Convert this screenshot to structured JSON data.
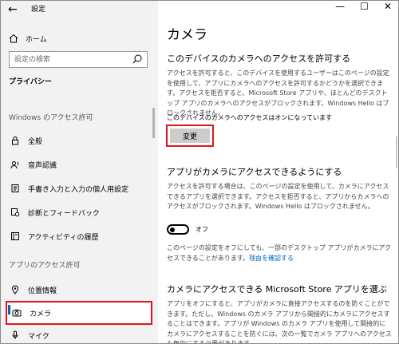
{
  "window": {
    "title": "設定",
    "controls": {
      "minimize": "—",
      "maximize": "☐",
      "close": "✕"
    }
  },
  "sidebar": {
    "home_label": "ホーム",
    "search_placeholder": "設定の検索",
    "category": "プライバシー",
    "section1": "Windows のアクセス許可",
    "items1": [
      {
        "label": "全般",
        "icon": "lock-icon"
      },
      {
        "label": "音声認識",
        "icon": "speech-icon"
      },
      {
        "label": "手書き入力と入力の個人用設定",
        "icon": "pen-icon"
      },
      {
        "label": "診断とフィードバック",
        "icon": "diagnostics-icon"
      },
      {
        "label": "アクティビティの履歴",
        "icon": "history-icon"
      }
    ],
    "section2": "アプリのアクセス許可",
    "items2": [
      {
        "label": "位置情報",
        "icon": "location-icon"
      },
      {
        "label": "カメラ",
        "icon": "camera-icon",
        "active": true
      },
      {
        "label": "マイク",
        "icon": "mic-icon"
      }
    ]
  },
  "main": {
    "page_title": "カメラ",
    "section1": {
      "heading": "このデバイスのカメラへのアクセスを許可する",
      "description": "アクセスを許可すると、このデバイスを使用するユーザーはこのページの設定を使用して、アプリにカメラへのアクセスを許可するかどうかを選択できます。アクセスを拒否すると、Microsoft Store アプリや、ほとんどのデスクトップ アプリのカメラへのアクセスがブロックされます。Windows Hello はブロックされません。",
      "status": "このデバイスのカメラへのアクセスはオンになっています",
      "change_button": "変更"
    },
    "section2": {
      "heading": "アプリがカメラにアクセスできるようにする",
      "description": "アクセスを許可する場合は、このページの設定を使用して、カメラにアクセスできるアプリを選択できます。アクセスを拒否すると、アプリからカメラへのアクセスがブロックされます。Windows Hello はブロックされません。",
      "toggle_label": "オフ",
      "toggle_state": "off",
      "note": "このページの設定をオフにしても、一部のデスクトップ アプリがカメラにアクセスできることがあります。",
      "link": "理由を確認する"
    },
    "section3": {
      "heading": "カメラにアクセスできる Microsoft Store アプリを選ぶ",
      "description": "アプリをオフにすると、アプリがカメラに直接アクセスするのを防ぐことができます。ただし、Windows のカメラ アプリから間接的にカメラにアクセスすることはできます。アプリが Windows のカメラ アプリを使用して間接的にカメラにアクセスすることを防ぐには、次の一覧でカメラ アプリへのアクセスも無効にする必要があります。"
    }
  },
  "colors": {
    "accent": "#0067c0",
    "highlight": "#e3131c",
    "sidebar_bg": "#f2f2f2",
    "button_bg": "#cccccc"
  }
}
